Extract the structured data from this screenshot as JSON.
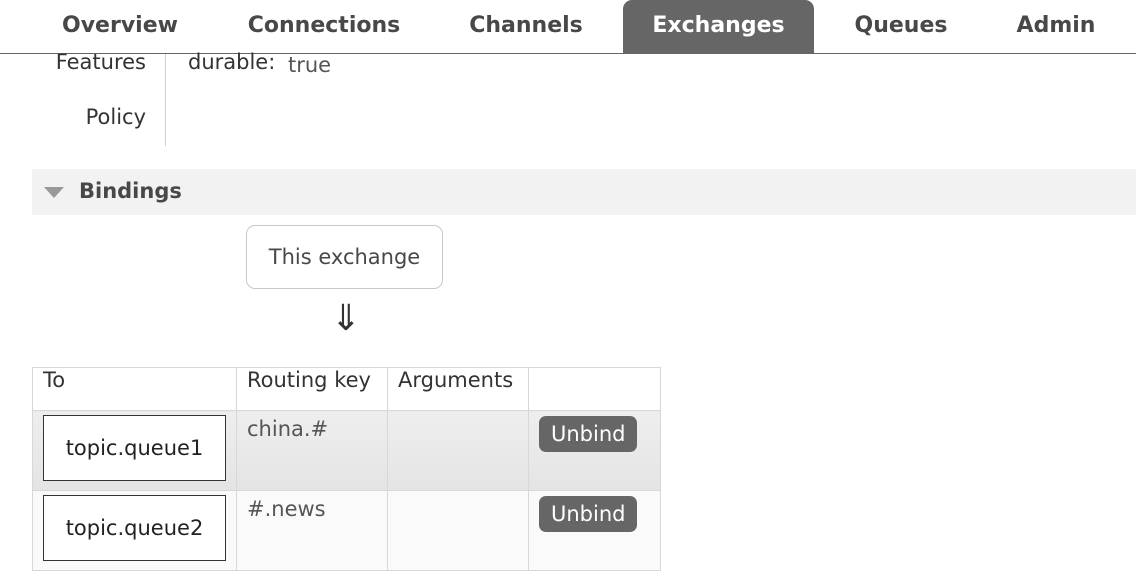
{
  "nav": {
    "tabs": [
      {
        "label": "Overview"
      },
      {
        "label": "Connections"
      },
      {
        "label": "Channels"
      },
      {
        "label": "Exchanges",
        "active": true
      },
      {
        "label": "Queues"
      },
      {
        "label": "Admin"
      }
    ]
  },
  "details": {
    "features_label": "Features",
    "policy_label": "Policy",
    "durable_key": "durable:",
    "durable_value": "true"
  },
  "bindings": {
    "title": "Bindings",
    "this_exchange": "This exchange",
    "arrow": "⇓",
    "columns": [
      "To",
      "Routing key",
      "Arguments",
      ""
    ],
    "rows": [
      {
        "to": "topic.queue1",
        "routing_key": "china.#",
        "arguments": "",
        "action": "Unbind"
      },
      {
        "to": "topic.queue2",
        "routing_key": "#.news",
        "arguments": "",
        "action": "Unbind"
      }
    ]
  },
  "colors": {
    "active_tab": "#666666",
    "section_header_bg": "#f2f2f2",
    "text": "#484848"
  }
}
